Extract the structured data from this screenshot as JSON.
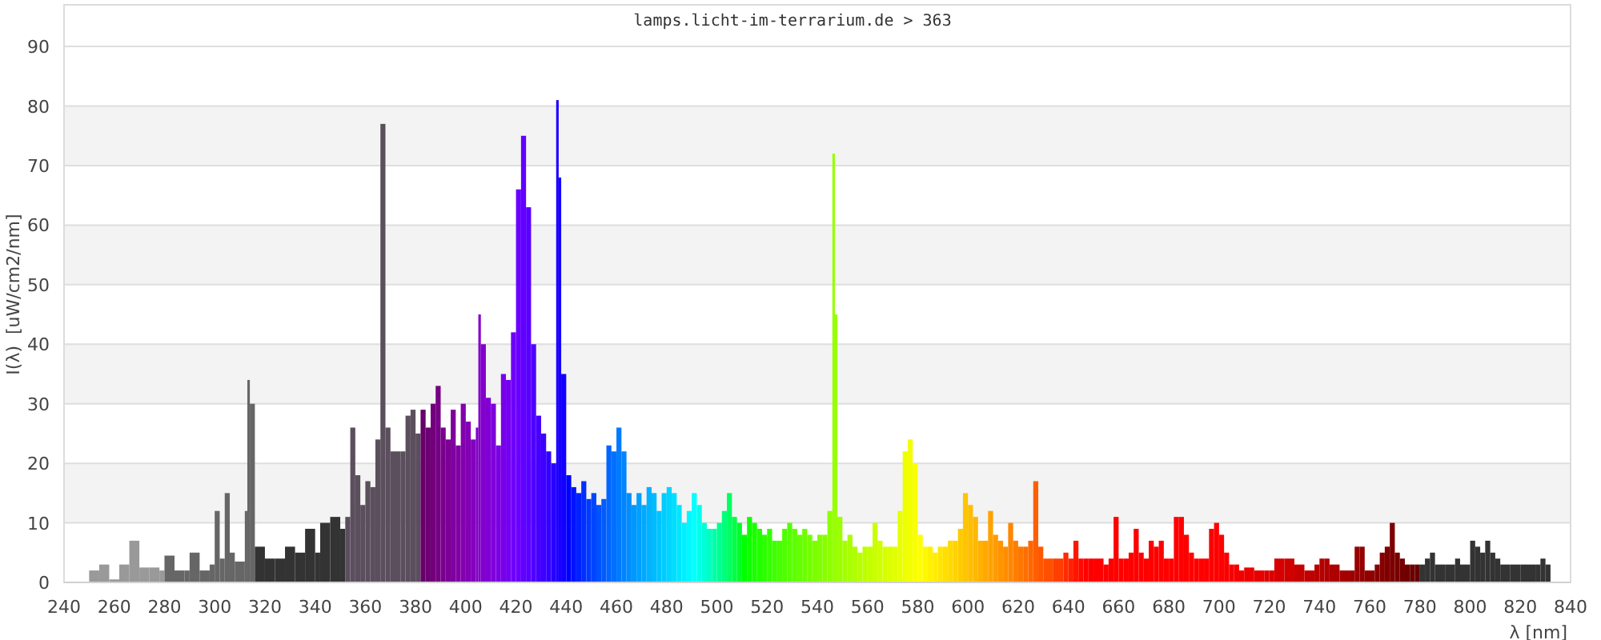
{
  "chart": {
    "chart_data": {
      "type": "bar",
      "title": "lamps.licht-im-terrarium.de > 363",
      "xlabel": "λ [nm]",
      "ylabel": "I(λ)  [uW/cm2/nm]",
      "xlim": [
        240,
        840
      ],
      "ylim": [
        0,
        97
      ],
      "grid": true,
      "xticks": [
        240,
        260,
        280,
        300,
        320,
        340,
        360,
        380,
        400,
        420,
        440,
        460,
        480,
        500,
        520,
        540,
        560,
        580,
        600,
        620,
        640,
        660,
        680,
        700,
        720,
        740,
        760,
        780,
        800,
        820,
        840
      ],
      "yticks": [
        0,
        10,
        20,
        30,
        40,
        50,
        60,
        70,
        80,
        90
      ],
      "x": [
        250,
        254,
        258,
        262,
        266,
        270,
        274,
        278,
        280,
        284,
        288,
        290,
        294,
        298,
        300,
        302,
        304,
        306,
        308,
        312,
        313,
        314,
        316,
        320,
        324,
        328,
        332,
        336,
        340,
        342,
        346,
        350,
        352,
        354,
        356,
        358,
        360,
        362,
        364,
        366,
        368,
        370,
        374,
        376,
        378,
        380,
        382,
        384,
        386,
        388,
        390,
        392,
        394,
        396,
        398,
        400,
        402,
        404,
        405,
        406,
        408,
        410,
        412,
        414,
        416,
        418,
        420,
        422,
        424,
        426,
        428,
        430,
        432,
        434,
        436,
        437,
        438,
        440,
        442,
        444,
        446,
        448,
        450,
        452,
        454,
        456,
        458,
        460,
        462,
        464,
        466,
        468,
        470,
        472,
        474,
        476,
        478,
        480,
        482,
        484,
        486,
        488,
        490,
        492,
        494,
        496,
        498,
        500,
        502,
        504,
        506,
        508,
        510,
        512,
        514,
        516,
        518,
        520,
        522,
        524,
        526,
        528,
        530,
        532,
        534,
        536,
        538,
        540,
        542,
        544,
        546,
        547,
        548,
        550,
        552,
        554,
        556,
        558,
        560,
        562,
        564,
        566,
        568,
        570,
        572,
        574,
        576,
        578,
        580,
        582,
        584,
        586,
        588,
        590,
        592,
        594,
        596,
        598,
        600,
        602,
        604,
        606,
        608,
        610,
        612,
        614,
        616,
        618,
        620,
        622,
        624,
        626,
        628,
        630,
        634,
        638,
        640,
        642,
        644,
        646,
        648,
        650,
        654,
        656,
        658,
        660,
        662,
        664,
        666,
        668,
        670,
        672,
        674,
        676,
        678,
        680,
        682,
        684,
        686,
        688,
        690,
        692,
        694,
        696,
        698,
        700,
        702,
        704,
        706,
        708,
        710,
        714,
        718,
        720,
        722,
        726,
        730,
        734,
        738,
        740,
        742,
        744,
        748,
        752,
        754,
        756,
        758,
        762,
        764,
        766,
        768,
        770,
        772,
        774,
        776,
        778,
        780,
        782,
        784,
        786,
        790,
        794,
        796,
        800,
        802,
        804,
        806,
        808,
        810,
        812,
        816,
        820,
        826,
        828,
        830
      ],
      "values": [
        2,
        3,
        0.5,
        3,
        7,
        2.5,
        2.5,
        2,
        4.5,
        2,
        2,
        5,
        2,
        3,
        12,
        4,
        15,
        5,
        3.5,
        12,
        34,
        30,
        6,
        4,
        4,
        6,
        5,
        9,
        5,
        10,
        11,
        9,
        11,
        26,
        18,
        13,
        17,
        16,
        24,
        77,
        26,
        22,
        22,
        28,
        29,
        25,
        29,
        26,
        30,
        33,
        26,
        24,
        29,
        23,
        30,
        27,
        24,
        26,
        45,
        40,
        31,
        30,
        23,
        35,
        34,
        42,
        66,
        75,
        63,
        40,
        28,
        25,
        22,
        20,
        81,
        68,
        35,
        18,
        16,
        15,
        17,
        14,
        15,
        13,
        14,
        23,
        22,
        26,
        22,
        15,
        13,
        15,
        13,
        16,
        15,
        12,
        15,
        16,
        15,
        13,
        10,
        12,
        15,
        13,
        10,
        9,
        9,
        10,
        12,
        15,
        11,
        10,
        8,
        11,
        10,
        9,
        8,
        9,
        7,
        7,
        9,
        10,
        9,
        8,
        9,
        8,
        7,
        8,
        8,
        12,
        72,
        45,
        11,
        7,
        8,
        6,
        5,
        6,
        6,
        10,
        7,
        6,
        6,
        6,
        12,
        22,
        24,
        20,
        8,
        6,
        6,
        5,
        6,
        6,
        7,
        7,
        9,
        15,
        13,
        11,
        7,
        7,
        12,
        8,
        7,
        6,
        10,
        7,
        6,
        6,
        7,
        17,
        6,
        4,
        4,
        5,
        4,
        7,
        4,
        4,
        4,
        4,
        3,
        4,
        11,
        4,
        4,
        5,
        9,
        5,
        4,
        7,
        6,
        7,
        4,
        4,
        11,
        11,
        8,
        5,
        4,
        4,
        4,
        9,
        10,
        8,
        5,
        3,
        3,
        2,
        2.5,
        2,
        2,
        2,
        4,
        4,
        3,
        2,
        3,
        4,
        4,
        3,
        2,
        2,
        6,
        6,
        2,
        3,
        5,
        6,
        10,
        5,
        4,
        3,
        3,
        3,
        3,
        4,
        5,
        3,
        3,
        4,
        3,
        7,
        6,
        5,
        7,
        5,
        4,
        3,
        3,
        3,
        3,
        4,
        3
      ]
    }
  }
}
